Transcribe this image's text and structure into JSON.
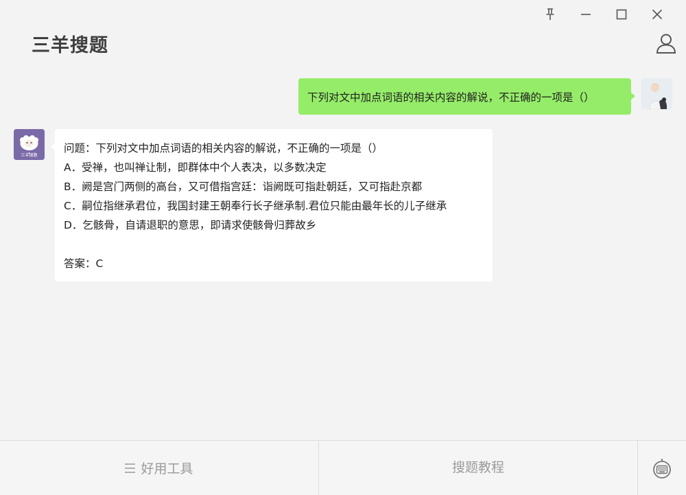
{
  "app": {
    "title": "三羊搜题"
  },
  "window_controls": [
    "pin",
    "minimize",
    "maximize",
    "close"
  ],
  "chat": {
    "user_message": "下列对文中加点词语的相关内容的解说，不正确的一项是（）",
    "bot_avatar_label": "三羊搜题",
    "bot_message": {
      "lines": [
        "问题：下列对文中加点词语的相关内容的解说，不正确的一项是（）",
        "A．受禅，也叫禅让制，即群体中个人表决，以多数决定",
        "B．阙是宫门两侧的高台，又可借指宫廷：诣阙既可指赴朝廷，又可指赴京都",
        "C．嗣位指继承君位，我国封建王朝奉行长子继承制.君位只能由最年长的儿子继承",
        "D．乞骸骨，自请退职的意思，即请求使骸骨归葬故乡"
      ],
      "answer": "答案：C"
    }
  },
  "bottom_bar": {
    "tools_label": "好用工具",
    "tutorial_label": "搜题教程"
  },
  "colors": {
    "background": "#f3f3f3",
    "user_bubble": "#95ec69",
    "bot_bubble": "#ffffff",
    "bot_avatar": "#7a6aa8"
  },
  "icons": [
    "pin-icon",
    "minimize-icon",
    "maximize-icon",
    "close-icon",
    "user-icon",
    "menu-icon",
    "keyboard-icon"
  ]
}
